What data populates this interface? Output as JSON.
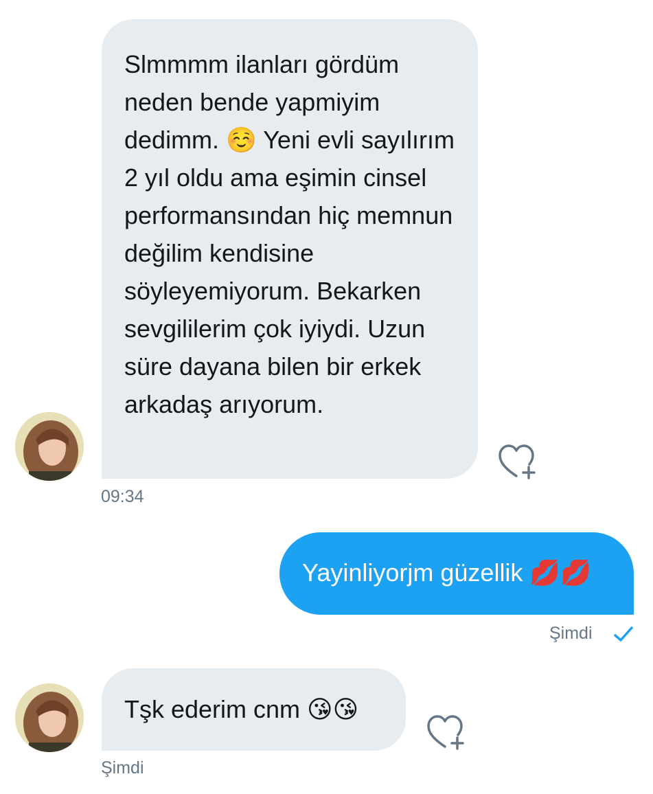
{
  "conversation": {
    "messages": [
      {
        "direction": "incoming",
        "text": "Slmmmm ilanları gördüm neden bende yapmiyim dedimm. ☺️ Yeni evli sayılırım 2 yıl oldu ama eşimin cinsel performansından hiç memnun değilim kendisine söyleyemiyorum. Bekarken sevgililerim çok iyiydi. Uzun süre dayana bilen bir erkek arkadaş arıyorum.",
        "time": "09:34"
      },
      {
        "direction": "outgoing",
        "text": "Yayinliyorjm güzellik 💋💋",
        "time": "Şimdi",
        "status": "sent"
      },
      {
        "direction": "incoming",
        "text": "Tşk ederim cnm 😘😘",
        "time": "Şimdi"
      }
    ]
  },
  "colors": {
    "incoming_bubble": "#e6ecf0",
    "outgoing_bubble": "#1da1f2",
    "timestamp": "#657786",
    "check": "#1da1f2"
  },
  "icons": {
    "like": "heart-plus-icon",
    "status": "checkmark-icon"
  }
}
